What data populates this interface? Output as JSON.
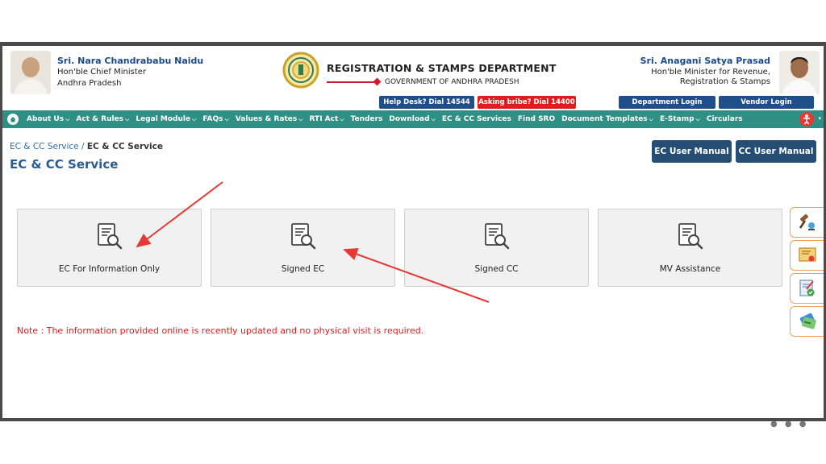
{
  "header": {
    "left_person": {
      "name": "Sri. Nara Chandrababu Naidu",
      "role": "Hon'ble Chief Minister",
      "state": "Andhra Pradesh"
    },
    "department": {
      "title": "REGISTRATION & STAMPS DEPARTMENT",
      "subtitle": "GOVERNMENT OF ANDHRA PRADESH"
    },
    "right_person": {
      "name": "Sri. Anagani Satya Prasad",
      "role_line1": "Hon'ble Minister for Revenue,",
      "role_line2": "Registration & Stamps"
    },
    "buttons": {
      "helpdesk": "Help Desk? Dial 14544",
      "bribe": "Asking bribe? Dial 14400",
      "department_login": "Department Login",
      "vendor_login": "Vendor Login"
    }
  },
  "nav": {
    "items": [
      {
        "label": "About Us",
        "dropdown": true
      },
      {
        "label": "Act & Rules",
        "dropdown": true
      },
      {
        "label": "Legal Module",
        "dropdown": true
      },
      {
        "label": "FAQs",
        "dropdown": true
      },
      {
        "label": "Values & Rates",
        "dropdown": true
      },
      {
        "label": "RTI Act",
        "dropdown": true
      },
      {
        "label": "Tenders",
        "dropdown": false
      },
      {
        "label": "Download",
        "dropdown": true
      },
      {
        "label": "EC & CC Services",
        "dropdown": false
      },
      {
        "label": "Find SRO",
        "dropdown": false
      },
      {
        "label": "Document Templates",
        "dropdown": true
      },
      {
        "label": "E-Stamp",
        "dropdown": true
      },
      {
        "label": "Circulars",
        "dropdown": false
      }
    ],
    "chevron": "⌵"
  },
  "breadcrumb": {
    "parent": "EC & CC Service",
    "separator": "/",
    "current": "EC & CC Service"
  },
  "page_title": "EC & CC Service",
  "manuals": {
    "ec": "EC User Manual",
    "cc": "CC User Manual"
  },
  "cards": [
    {
      "label": "EC For Information Only",
      "icon": "document-search-icon"
    },
    {
      "label": "Signed EC",
      "icon": "document-search-icon"
    },
    {
      "label": "Signed CC",
      "icon": "document-search-icon"
    },
    {
      "label": "MV Assistance",
      "icon": "document-search-icon"
    }
  ],
  "note": "Note : The information provided online is recently updated and no physical visit is required.",
  "colors": {
    "nav": "#2f8f84",
    "brand_blue": "#1f4f8a",
    "alert_red": "#e01c1c",
    "arrow_red": "#e53935"
  }
}
